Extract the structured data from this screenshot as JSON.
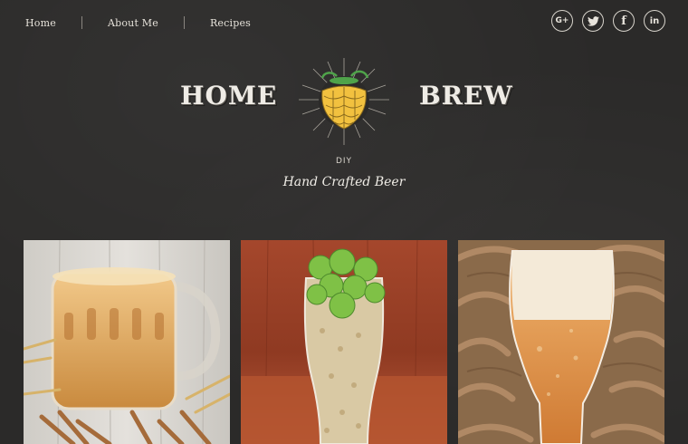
{
  "nav": {
    "items": [
      {
        "label": "Home"
      },
      {
        "label": "About Me"
      },
      {
        "label": "Recipes"
      }
    ]
  },
  "social": {
    "icons": [
      "google-plus-icon",
      "twitter-icon",
      "facebook-icon",
      "linkedin-icon"
    ],
    "glyphs": [
      "G+",
      "🐦",
      "f",
      "in"
    ]
  },
  "brand": {
    "word_left": "HOME",
    "word_right": "BREW",
    "subtitle": "DIY",
    "tagline": "Hand Crafted Beer"
  },
  "colors": {
    "background": "#2b2a29",
    "hop_yellow": "#f2c13f",
    "leaf_green": "#4fa34a",
    "text": "#efece6"
  },
  "gallery": [
    {
      "icon": "beer-mug-with-wheat-image"
    },
    {
      "icon": "hops-and-barley-glass-image"
    },
    {
      "icon": "beer-glass-on-wicker-image"
    }
  ]
}
